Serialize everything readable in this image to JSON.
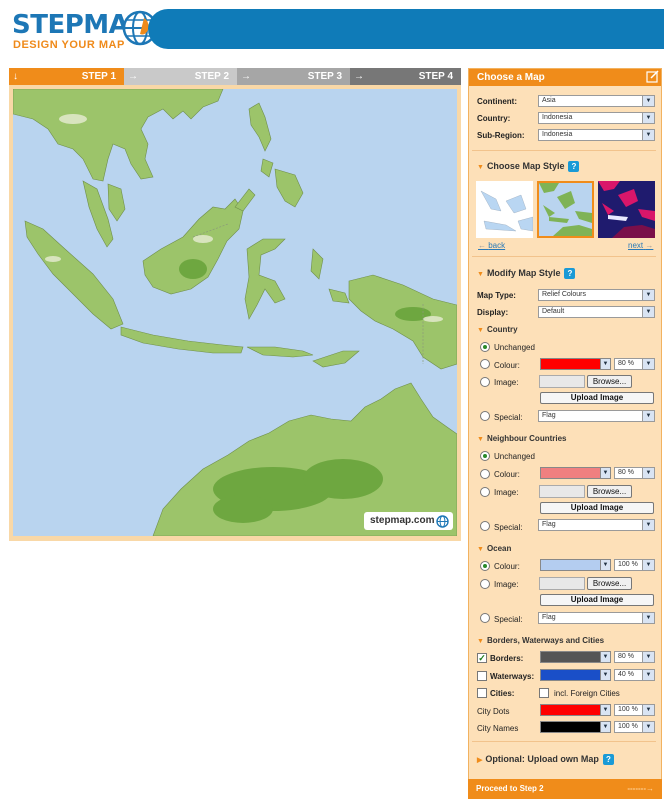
{
  "brand": {
    "word": "STEPMAP",
    "tagline": "DESIGN YOUR MAP"
  },
  "steps": [
    {
      "label": "STEP",
      "num": "1"
    },
    {
      "label": "STEP",
      "num": "2"
    },
    {
      "label": "STEP",
      "num": "3"
    },
    {
      "label": "STEP",
      "num": "4"
    }
  ],
  "map": {
    "watermark": "stepmap.com"
  },
  "panel": {
    "title": "Choose a Map",
    "continent": {
      "label": "Continent:",
      "value": "Asia"
    },
    "country": {
      "label": "Country:",
      "value": "Indonesia"
    },
    "subregion": {
      "label": "Sub-Region:",
      "value": "Indonesia"
    },
    "style_title": "Choose Map Style",
    "back": "back",
    "next": "next",
    "modify_title": "Modify Map Style",
    "map_type": {
      "label": "Map Type:",
      "value": "Relief Colours"
    },
    "display": {
      "label": "Display:",
      "value": "Default"
    },
    "country_sec": {
      "title": "Country",
      "unchanged": "Unchanged",
      "colour": "Colour:",
      "colour_pct": "80 %",
      "image": "Image:",
      "browse": "Browse...",
      "upload": "Upload Image",
      "special": "Special:",
      "special_value": "Flag"
    },
    "neighbour_sec": {
      "title": "Neighbour Countries",
      "unchanged": "Unchanged",
      "colour": "Colour:",
      "colour_pct": "80 %",
      "image": "Image:",
      "browse": "Browse...",
      "upload": "Upload Image",
      "special": "Special:",
      "special_value": "Flag"
    },
    "ocean_sec": {
      "title": "Ocean",
      "colour": "Colour:",
      "colour_pct": "100 %",
      "image": "Image:",
      "browse": "Browse...",
      "upload": "Upload Image",
      "special": "Special:",
      "special_value": "Flag"
    },
    "borders_sec": {
      "title": "Borders, Waterways and Cities",
      "borders": "Borders:",
      "borders_pct": "80 %",
      "waterways": "Waterways:",
      "waterways_pct": "40 %",
      "cities": "Cities:",
      "foreign": "incl. Foreign Cities",
      "city_dots": "City Dots",
      "city_dots_pct": "100 %",
      "city_names": "City Names",
      "city_names_pct": "100 %"
    },
    "optional": "Optional: Upload own Map",
    "proceed": "Proceed to Step 2"
  },
  "colors": {
    "brand_blue": "#0f7bb8",
    "accent_orange": "#f08c1a",
    "country_colour": "#ff0000",
    "neighbour_colour": "#f08080",
    "ocean_colour": "#b4cdf0",
    "borders_colour": "#555555",
    "waterways_colour": "#1a4fc8",
    "city_dots_colour": "#ff0000",
    "city_names_colour": "#000000"
  }
}
